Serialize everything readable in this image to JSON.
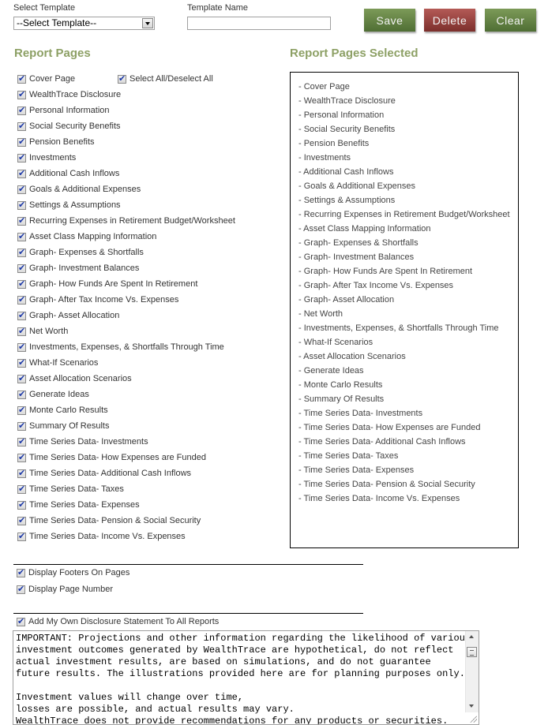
{
  "header": {
    "select_template_label": "Select Template",
    "select_template_value": "--Select Template--",
    "template_name_label": "Template Name",
    "template_name_value": "",
    "save_label": "Save",
    "delete_label": "Delete",
    "clear_label": "Clear"
  },
  "report_pages": {
    "title": "Report Pages",
    "select_all_label": "Select All/Deselect All",
    "select_all_checked": true,
    "items": [
      {
        "label": "Cover Page",
        "checked": true
      },
      {
        "label": "WealthTrace Disclosure",
        "checked": true
      },
      {
        "label": "Personal Information",
        "checked": true
      },
      {
        "label": "Social Security Benefits",
        "checked": true
      },
      {
        "label": "Pension Benefits",
        "checked": true
      },
      {
        "label": "Investments",
        "checked": true
      },
      {
        "label": "Additional Cash Inflows",
        "checked": true
      },
      {
        "label": "Goals & Additional Expenses",
        "checked": true
      },
      {
        "label": "Settings & Assumptions",
        "checked": true
      },
      {
        "label": "Recurring Expenses in Retirement Budget/Worksheet",
        "checked": true
      },
      {
        "label": "Asset Class Mapping Information",
        "checked": true
      },
      {
        "label": "Graph- Expenses & Shortfalls",
        "checked": true
      },
      {
        "label": "Graph- Investment Balances",
        "checked": true
      },
      {
        "label": "Graph- How Funds Are Spent In Retirement",
        "checked": true
      },
      {
        "label": "Graph- After Tax Income Vs. Expenses",
        "checked": true
      },
      {
        "label": "Graph- Asset Allocation",
        "checked": true
      },
      {
        "label": "Net Worth",
        "checked": true
      },
      {
        "label": "Investments, Expenses, & Shortfalls Through Time",
        "checked": true
      },
      {
        "label": "What-If Scenarios",
        "checked": true
      },
      {
        "label": "Asset Allocation Scenarios",
        "checked": true
      },
      {
        "label": "Generate Ideas",
        "checked": true
      },
      {
        "label": "Monte Carlo Results",
        "checked": true
      },
      {
        "label": "Summary Of Results",
        "checked": true
      },
      {
        "label": "Time Series Data- Investments",
        "checked": true
      },
      {
        "label": "Time Series Data- How Expenses are Funded",
        "checked": true
      },
      {
        "label": "Time Series Data- Additional Cash Inflows",
        "checked": true
      },
      {
        "label": "Time Series Data- Taxes",
        "checked": true
      },
      {
        "label": "Time Series Data- Expenses",
        "checked": true
      },
      {
        "label": "Time Series Data- Pension & Social Security",
        "checked": true
      },
      {
        "label": "Time Series Data- Income Vs. Expenses",
        "checked": true
      }
    ]
  },
  "selected_pages": {
    "title": "Report Pages Selected",
    "items": [
      "- Cover Page",
      "- WealthTrace Disclosure",
      "- Personal Information",
      "- Social Security Benefits",
      "- Pension Benefits",
      "- Investments",
      "- Additional Cash Inflows",
      "- Goals & Additional Expenses",
      "- Settings & Assumptions",
      "- Recurring Expenses in Retirement Budget/Worksheet",
      "- Asset Class Mapping Information",
      "- Graph- Expenses & Shortfalls",
      "- Graph- Investment Balances",
      "- Graph- How Funds Are Spent In Retirement",
      "- Graph- After Tax Income Vs. Expenses",
      "- Graph- Asset Allocation",
      "- Net Worth",
      "- Investments, Expenses, & Shortfalls Through Time",
      "- What-If Scenarios",
      "- Asset Allocation Scenarios",
      "- Generate Ideas",
      "- Monte Carlo Results",
      "- Summary Of Results",
      "- Time Series Data- Investments",
      "- Time Series Data- How Expenses are Funded",
      "- Time Series Data- Additional Cash Inflows",
      "- Time Series Data- Taxes",
      "- Time Series Data- Expenses",
      "- Time Series Data- Pension & Social Security",
      "- Time Series Data- Income Vs. Expenses"
    ]
  },
  "options": {
    "display_footers_label": "Display Footers On Pages",
    "display_footers_checked": true,
    "display_page_number_label": "Display Page Number",
    "display_page_number_checked": true,
    "own_disclosure_label": "Add My Own Disclosure Statement To All Reports",
    "own_disclosure_checked": true,
    "disclosure_text": "IMPORTANT: Projections and other information regarding the likelihood of various\ninvestment outcomes generated by WealthTrace are hypothetical, do not reflect\nactual investment results, are based on simulations, and do not guarantee\nfuture results. The illustrations provided here are for planning purposes only.\n\nInvestment values will change over time,\nlosses are possible, and actual results may vary.\nWealthTrace does not provide recommendations for any products or securities."
  },
  "colors": {
    "heading": "#8da065",
    "save_button": "#6a8747",
    "delete_button": "#9a4441",
    "clear_button": "#6a8747"
  }
}
